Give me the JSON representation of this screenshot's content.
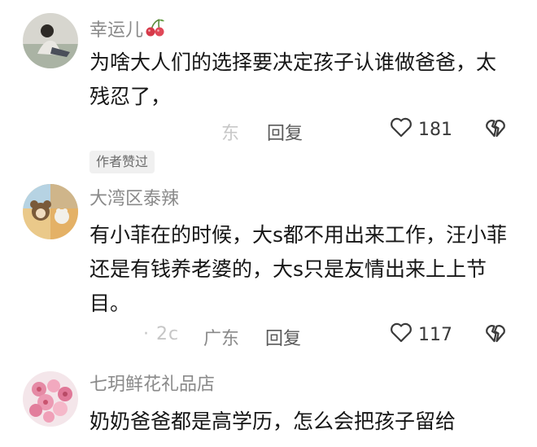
{
  "comments": [
    {
      "username": "幸运儿",
      "username_emoji": "cherries",
      "content": "为啥大人们的选择要决定孩子认谁做爸爸，太残忍了，",
      "time_text": "",
      "location": "东",
      "reply_label": "回复",
      "like_count": "181",
      "badge": "作者赞过"
    },
    {
      "username": "大湾区泰辣",
      "content": "有小菲在的时候，大s都不用出来工作，汪小菲还是有钱养老婆的，大s只是友情出来上上节目。",
      "time_text": "· 2c",
      "location": "广东",
      "reply_label": "回复",
      "like_count": "117"
    },
    {
      "username": "七玥鲜花礼品店",
      "content": "奶奶爸爸都是高学历，怎么会把孩子留给"
    }
  ],
  "icons": {
    "like": "heart-outline-icon",
    "dislike": "broken-heart-icon",
    "emoji": "cherry-icon"
  },
  "colors": {
    "username": "#8a8a8a",
    "text": "#161616",
    "badge_bg": "#f0f0f0"
  }
}
